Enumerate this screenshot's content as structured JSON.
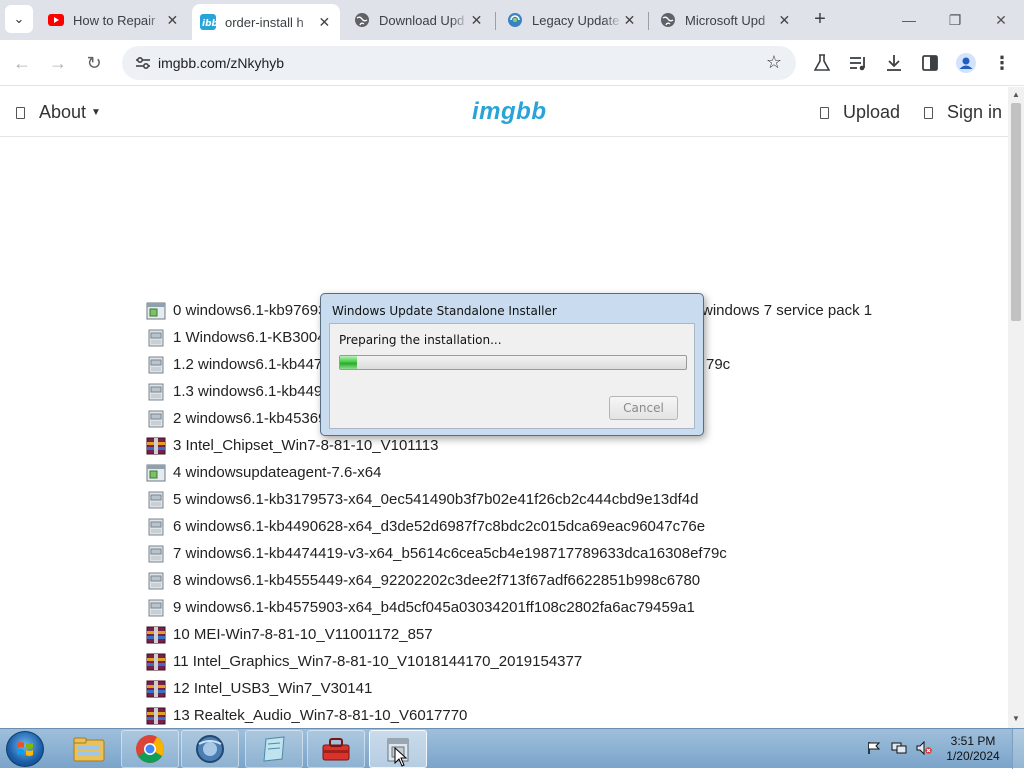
{
  "browser": {
    "tabs": [
      {
        "title": "How to Repair",
        "icon": "youtube-icon"
      },
      {
        "title": "order-install h",
        "icon": "imgbb-icon",
        "active": true
      },
      {
        "title": "Download Upd",
        "icon": "globe-icon"
      },
      {
        "title": "Legacy Update",
        "icon": "legacy-update-icon"
      },
      {
        "title": "Microsoft Upd",
        "icon": "globe-icon"
      }
    ],
    "new_tab": "+",
    "url": "imgbb.com/zNkyhyb"
  },
  "site": {
    "about": "About",
    "logo": "imgbb",
    "upload": "Upload",
    "sign_in": "Sign in"
  },
  "files": [
    {
      "name": "0 windows6.1-kb97693",
      "suffix": "windows 7 service pack 1",
      "icon": "installer-icon"
    },
    {
      "name": "1 Windows6.1-KB3004",
      "icon": "update-package-icon"
    },
    {
      "name": "1.2 windows6.1-kb447",
      "suffix": "79c",
      "icon": "update-package-icon"
    },
    {
      "name": "1.3 windows6.1-kb449",
      "icon": "update-package-icon"
    },
    {
      "name": "2 windows6.1-kb45369",
      "icon": "update-package-icon"
    },
    {
      "name": "3 Intel_Chipset_Win7-8-81-10_V101113",
      "icon": "archive-icon"
    },
    {
      "name": "4 windowsupdateagent-7.6-x64",
      "icon": "installer-icon"
    },
    {
      "name": "5 windows6.1-kb3179573-x64_0ec541490b3f7b02e41f26cb2c444cbd9e13df4d",
      "icon": "update-package-icon"
    },
    {
      "name": "6 windows6.1-kb4490628-x64_d3de52d6987f7c8bdc2c015dca69eac96047c76e",
      "icon": "update-package-icon"
    },
    {
      "name": "7 windows6.1-kb4474419-v3-x64_b5614c6cea5cb4e198717789633dca16308ef79c",
      "icon": "update-package-icon"
    },
    {
      "name": "8 windows6.1-kb4555449-x64_92202202c3dee2f713f67adf6622851b998c6780",
      "icon": "update-package-icon"
    },
    {
      "name": "9 windows6.1-kb4575903-x64_b4d5cf045a03034201ff108c2802fa6ac79459a1",
      "icon": "update-package-icon"
    },
    {
      "name": "10 MEI-Win7-8-81-10_V11001172_857",
      "icon": "archive-icon"
    },
    {
      "name": "11 Intel_Graphics_Win7-8-81-10_V1018144170_2019154377",
      "icon": "archive-icon"
    },
    {
      "name": "12 Intel_USB3_Win7_V30141",
      "icon": "archive-icon"
    },
    {
      "name": "13 Realtek_Audio_Win7-8-81-10_V6017770",
      "icon": "archive-icon"
    }
  ],
  "dialog": {
    "title": "Windows Update Standalone Installer",
    "message": "Preparing the installation...",
    "progress": 0.05,
    "cancel": "Cancel"
  },
  "taskbar": {
    "apps": [
      "explorer-icon",
      "chrome-icon",
      "browser-icon",
      "notepad-icon",
      "toolbox-icon",
      "installer-icon"
    ],
    "time": "3:51 PM",
    "date": "1/20/2024"
  },
  "colors": {
    "accent": "#2aa4d8",
    "progress": "#3cc33c"
  }
}
